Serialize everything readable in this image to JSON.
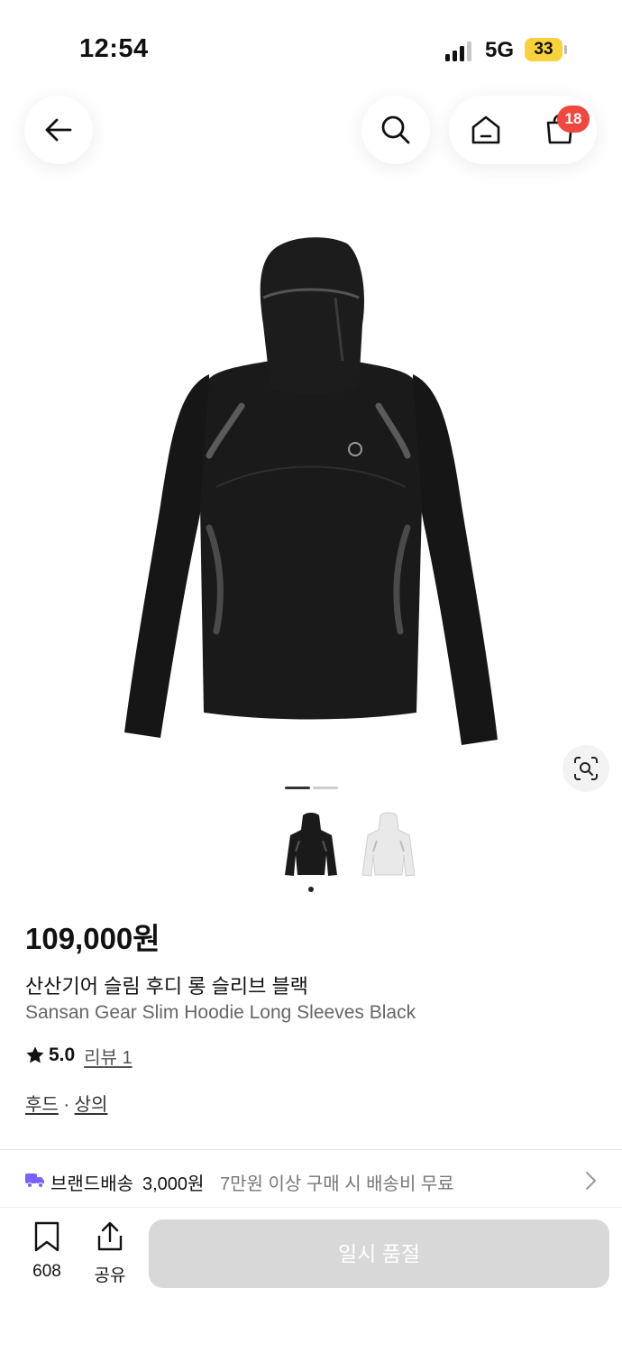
{
  "status_bar": {
    "time": "12:54",
    "network": "5G",
    "battery": "33"
  },
  "header": {
    "back_icon": "arrow-left-icon",
    "search_icon": "search-icon",
    "home_icon": "home-icon",
    "cart_icon": "shopping-bag-icon",
    "cart_count": "18"
  },
  "gallery": {
    "image_count": 2,
    "active_index": 0
  },
  "product": {
    "price": "109,000원",
    "name_ko": "산산기어 슬림 후디 롱 슬리브 블랙",
    "name_en": "Sansan Gear Slim Hoodie Long Sleeves Black",
    "rating": "5.0",
    "review_label": "리뷰 1",
    "category_1": "후드",
    "category_separator": " · ",
    "category_2": "상의"
  },
  "shipping": {
    "label": "브랜드배송",
    "fee": "3,000원",
    "note": "7만원 이상 구매 시 배송비 무료"
  },
  "bottom_bar": {
    "bookmark_count": "608",
    "share_label": "공유",
    "soldout_label": "일시 품절"
  },
  "colors": {
    "badge": "#f0473f",
    "battery": "#f7d23a",
    "truck": "#7b61ff",
    "disabled_button": "#d8d8d8"
  }
}
